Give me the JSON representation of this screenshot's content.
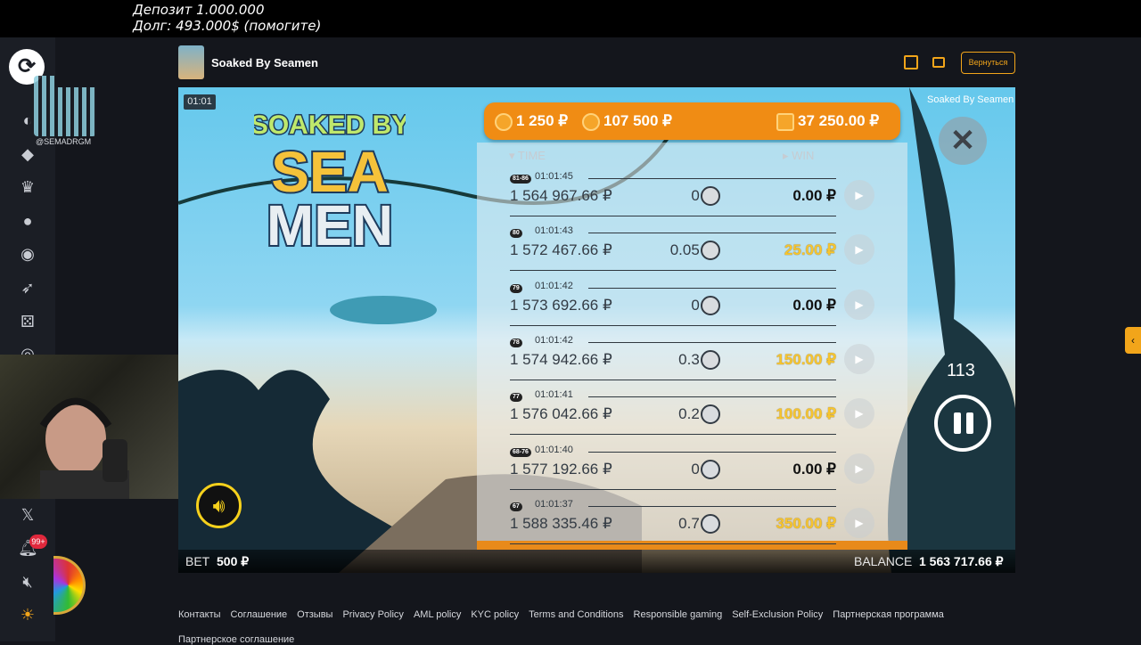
{
  "overlay": {
    "line1": "Депозит 1.000.000",
    "line2": "Долг: 493.000$ (помогите)"
  },
  "sidebar": {
    "qr_label": "@SEMADRGM",
    "notifications_count": "99+",
    "icons": [
      "logo-icon",
      "gamepad-icon",
      "ticket-icon",
      "trophy-icon",
      "user-icon",
      "poker-chip-icon",
      "rocket-icon",
      "dice-icon",
      "target-icon",
      "x-icon",
      "bell-icon",
      "mute-icon",
      "sun-icon"
    ]
  },
  "header": {
    "game_title": "Soaked By Seamen",
    "back_label": "Вернуться"
  },
  "game": {
    "timer": "01:01",
    "name_label": "Soaked By Seamen",
    "logo_line1": "SOAKED BY",
    "logo_line2": "SEA",
    "logo_line3": "MEN",
    "top_stats": {
      "bet_total": "1 250 ₽",
      "win_total": "107 500 ₽",
      "wallet": "37 250.00 ₽"
    },
    "history_headers": {
      "time": "TIME",
      "win": "WIN"
    },
    "history": [
      {
        "badge": "81-86",
        "time": "01:01:45",
        "balance": "1 564 967.66 ₽",
        "mult": "0 x",
        "win": "0.00 ₽",
        "gold": false
      },
      {
        "badge": "80",
        "time": "01:01:43",
        "balance": "1 572 467.66 ₽",
        "mult": "0.05 x",
        "win": "25.00 ₽",
        "gold": true
      },
      {
        "badge": "79",
        "time": "01:01:42",
        "balance": "1 573 692.66 ₽",
        "mult": "0 x",
        "win": "0.00 ₽",
        "gold": false
      },
      {
        "badge": "78",
        "time": "01:01:42",
        "balance": "1 574 942.66 ₽",
        "mult": "0.3 x",
        "win": "150.00 ₽",
        "gold": true
      },
      {
        "badge": "77",
        "time": "01:01:41",
        "balance": "1 576 042.66 ₽",
        "mult": "0.2 x",
        "win": "100.00 ₽",
        "gold": true
      },
      {
        "badge": "68-76",
        "time": "01:01:40",
        "balance": "1 577 192.66 ₽",
        "mult": "0 x",
        "win": "0.00 ₽",
        "gold": false
      },
      {
        "badge": "67",
        "time": "01:01:37",
        "balance": "1 588 335.46 ₽",
        "mult": "0.7 x",
        "win": "350.00 ₽",
        "gold": true
      }
    ],
    "autoplay_count": "113",
    "bet_label": "BET",
    "bet_value": "500 ₽",
    "balance_label": "BALANCE",
    "balance_value": "1 563 717.66 ₽"
  },
  "footer": {
    "links": [
      "Контакты",
      "Соглашение",
      "Отзывы",
      "Privacy Policy",
      "AML policy",
      "KYC policy",
      "Terms and Conditions",
      "Responsible gaming",
      "Self-Exclusion Policy",
      "Партнерская программа"
    ],
    "second_line": "Партнерское соглашение"
  },
  "colors": {
    "accent": "#f2a51a",
    "panel_orange": "#f08c14",
    "win_gold": "#f7c52e"
  }
}
